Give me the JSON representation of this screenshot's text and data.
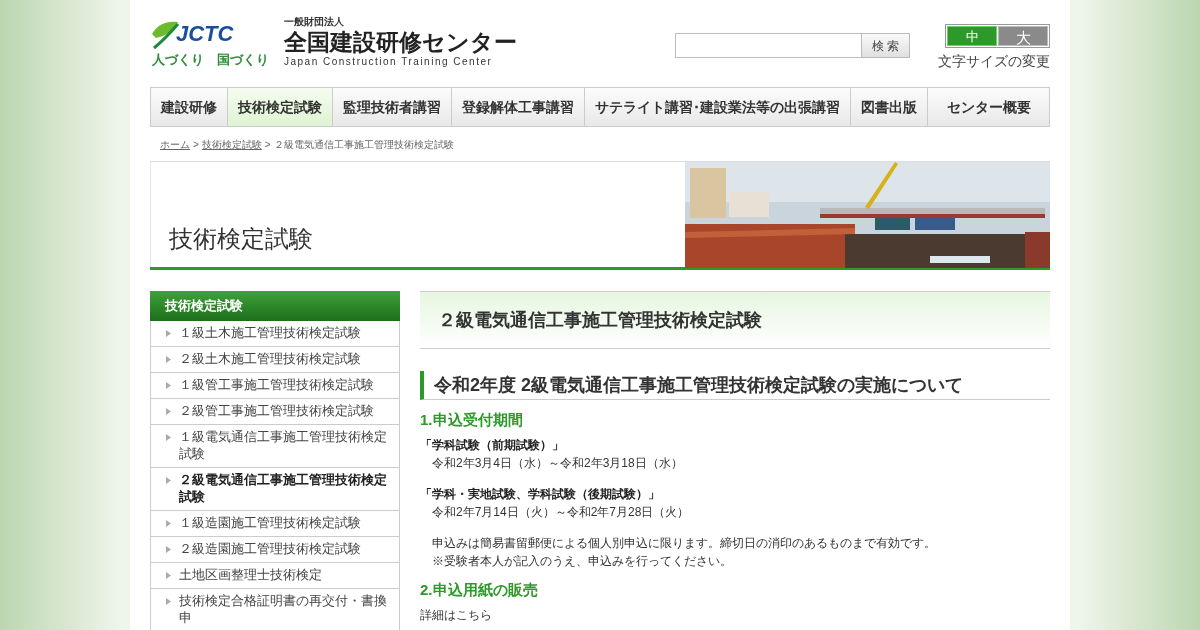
{
  "header": {
    "logo": {
      "mark": "JCTC",
      "tagline": "人づくり　国づくり",
      "org_type": "一般財団法人",
      "name": "全国建設研修センター",
      "english": "Japan Construction Training Center"
    },
    "search": {
      "button": "検 索"
    },
    "font_size": {
      "options": [
        {
          "label": "中",
          "selected": true
        },
        {
          "label": "大",
          "selected": false
        }
      ],
      "label": "文字サイズの変更"
    }
  },
  "nav": [
    {
      "label": "建設研修",
      "selected": false
    },
    {
      "label": "技術検定試験",
      "selected": true
    },
    {
      "label": "監理技術者講習",
      "selected": false
    },
    {
      "label": "登録解体工事講習",
      "selected": false
    },
    {
      "label": "サテライト講習･建設業法等の出張講習",
      "selected": false
    },
    {
      "label": "図書出版",
      "selected": false
    },
    {
      "label": "センター概要",
      "selected": false
    }
  ],
  "breadcrumb": [
    {
      "label": "ホーム",
      "kind": "link"
    },
    {
      "label": ">",
      "kind": "separator"
    },
    {
      "label": "技術検定試験",
      "kind": "link"
    },
    {
      "label": ">",
      "kind": "separator"
    },
    {
      "label": "２級電気通信工事施工管理技術検定試験",
      "kind": "current"
    }
  ],
  "banner": {
    "title": "技術検定試験"
  },
  "sidebar": {
    "title": "技術検定試験",
    "items": [
      {
        "label": "１級土木施工管理技術検定試験",
        "selected": false
      },
      {
        "label": "２級土木施工管理技術検定試験",
        "selected": false
      },
      {
        "label": "１級管工事施工管理技術検定試験",
        "selected": false
      },
      {
        "label": "２級管工事施工管理技術検定試験",
        "selected": false
      },
      {
        "label": "１級電気通信工事施工管理技術検定試験",
        "selected": false
      },
      {
        "label": "２級電気通信工事施工管理技術検定試験",
        "selected": true
      },
      {
        "label": "１級造園施工管理技術検定試験",
        "selected": false
      },
      {
        "label": "２級造園施工管理技術検定試験",
        "selected": false
      },
      {
        "label": "土地区画整理士技術検定",
        "selected": false
      },
      {
        "label": "技術検定合格証明書の再交付・書換申",
        "selected": false
      }
    ]
  },
  "main": {
    "page_title": "２級電気通信工事施工管理技術検定試験",
    "heading": "令和2年度 2級電気通信工事施工管理技術検定試験の実施について",
    "sections": [
      {
        "title": "1.申込受付期間",
        "paragraphs": [
          {
            "indent": true,
            "title": "「学科試験（前期試験）」",
            "lines": [
              "令和2年3月4日（水）～令和2年3月18日（水）"
            ]
          },
          {
            "indent": true,
            "title": "「学科・実地試験、学科試験（後期試験）」",
            "lines": [
              "令和2年7月14日（火）～令和2年7月28日（火）"
            ]
          },
          {
            "indent": true,
            "lines": [
              "申込みは簡易書留郵便による個人別申込に限ります。締切日の消印のあるものまで有効です。",
              "※受験者本人が記入のうえ、申込みを行ってください。"
            ]
          }
        ]
      },
      {
        "title": "2.申込用紙の販売",
        "paragraphs": [
          {
            "indent": false,
            "lines": [
              "詳細はこちら"
            ]
          }
        ]
      }
    ]
  }
}
